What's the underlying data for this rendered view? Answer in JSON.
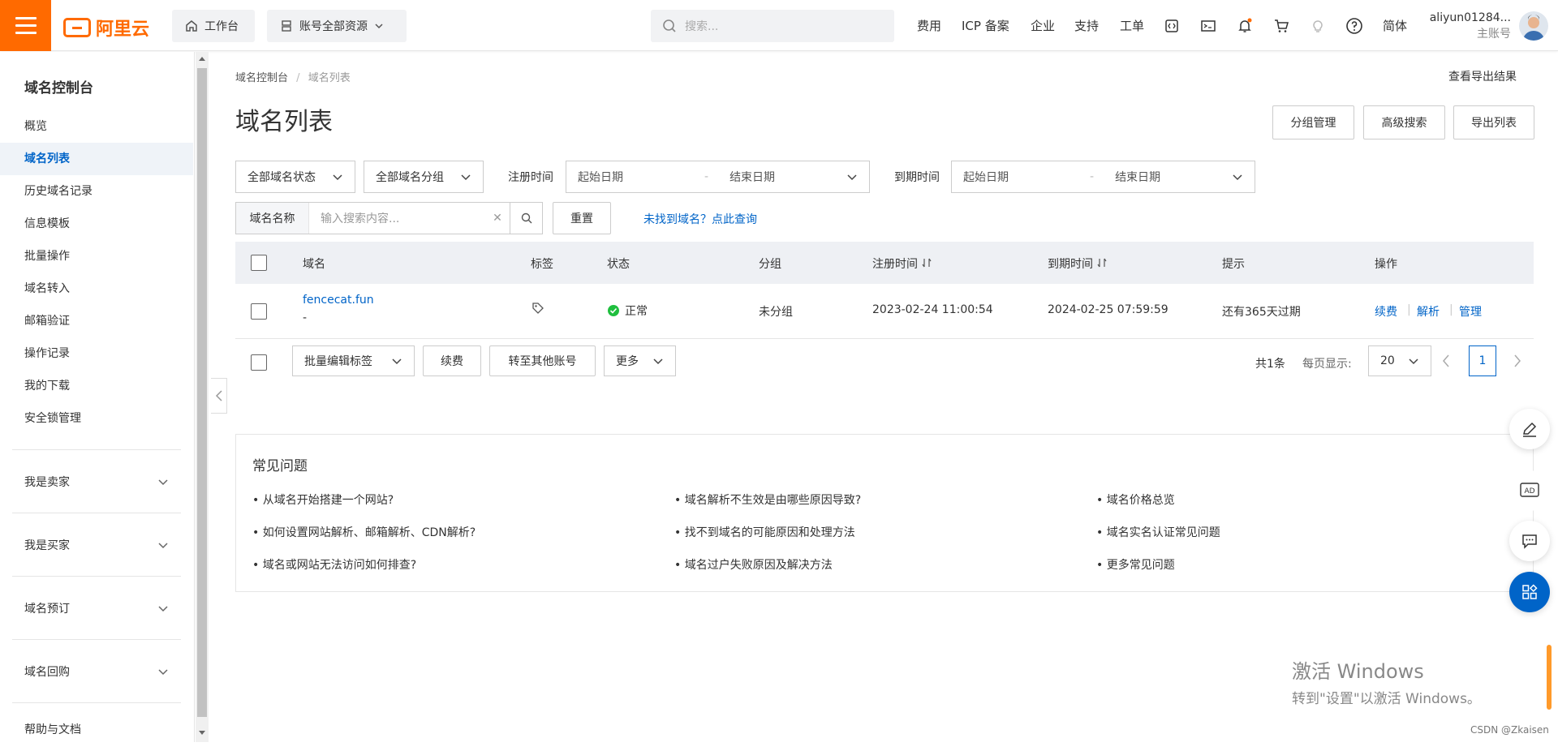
{
  "header": {
    "logo_text": "阿里云",
    "workbench": "工作台",
    "resources": "账号全部资源",
    "search_placeholder": "搜索...",
    "nav": [
      "费用",
      "ICP 备案",
      "企业",
      "支持",
      "工单"
    ],
    "lang": "简体",
    "user_name": "aliyun01284...",
    "user_role": "主账号"
  },
  "sidebar": {
    "title": "域名控制台",
    "items": [
      "概览",
      "域名列表",
      "历史域名记录",
      "信息模板",
      "批量操作",
      "域名转入",
      "邮箱验证",
      "操作记录",
      "我的下载",
      "安全锁管理"
    ],
    "active": "域名列表",
    "groups": [
      "我是卖家",
      "我是买家",
      "域名预订",
      "域名回购"
    ],
    "bottom": "帮助与文档"
  },
  "breadcrumb": {
    "root": "域名控制台",
    "sep": "/",
    "current": "域名列表"
  },
  "export_result": "查看导出结果",
  "page_title": "域名列表",
  "actions": {
    "group_manage": "分组管理",
    "advanced_search": "高级搜索",
    "export_list": "导出列表"
  },
  "filters": {
    "status": "全部域名状态",
    "group": "全部域名分组",
    "reg_time_label": "注册时间",
    "expire_time_label": "到期时间",
    "start_date": "起始日期",
    "end_date": "结束日期",
    "date_sep": "-",
    "name_label": "域名名称",
    "name_placeholder": "输入搜索内容...",
    "reset": "重置",
    "not_found_link": "未找到域名？点此查询"
  },
  "table": {
    "headers": {
      "domain": "域名",
      "tag": "标签",
      "status": "状态",
      "group": "分组",
      "reg_time": "注册时间",
      "expire_time": "到期时间",
      "hint": "提示",
      "ops": "操作"
    },
    "rows": [
      {
        "domain": "fencecat.fun",
        "sub": "-",
        "status": "正常",
        "group": "未分组",
        "reg_time": "2023-02-24 11:00:54",
        "expire_time": "2024-02-25 07:59:59",
        "hint": "还有365天过期",
        "op1": "续费",
        "op2": "解析",
        "op3": "管理"
      }
    ]
  },
  "bulk": {
    "edit_tags": "批量编辑标签",
    "renew": "续费",
    "transfer": "转至其他账号",
    "more": "更多",
    "total": "共1条",
    "per_page_label": "每页显示:",
    "per_page": "20",
    "current_page": "1"
  },
  "faq": {
    "title": "常见问题",
    "col1": [
      "从域名开始搭建一个网站?",
      "如何设置网站解析、邮箱解析、CDN解析?",
      "域名或网站无法访问如何排查?"
    ],
    "col2": [
      "域名解析不生效是由哪些原因导致?",
      "找不到域名的可能原因和处理方法",
      "域名过户失败原因及解决方法"
    ],
    "col3": [
      "域名价格总览",
      "域名实名认证常见问题",
      "更多常见问题"
    ]
  },
  "watermark": {
    "line1": "激活 Windows",
    "line2": "转到\"设置\"以激活 Windows。"
  },
  "csdn": "CSDN @Zkaisen",
  "colors": {
    "brand": "#ff6a00",
    "link": "#0064c8",
    "success": "#1fbf3e"
  }
}
